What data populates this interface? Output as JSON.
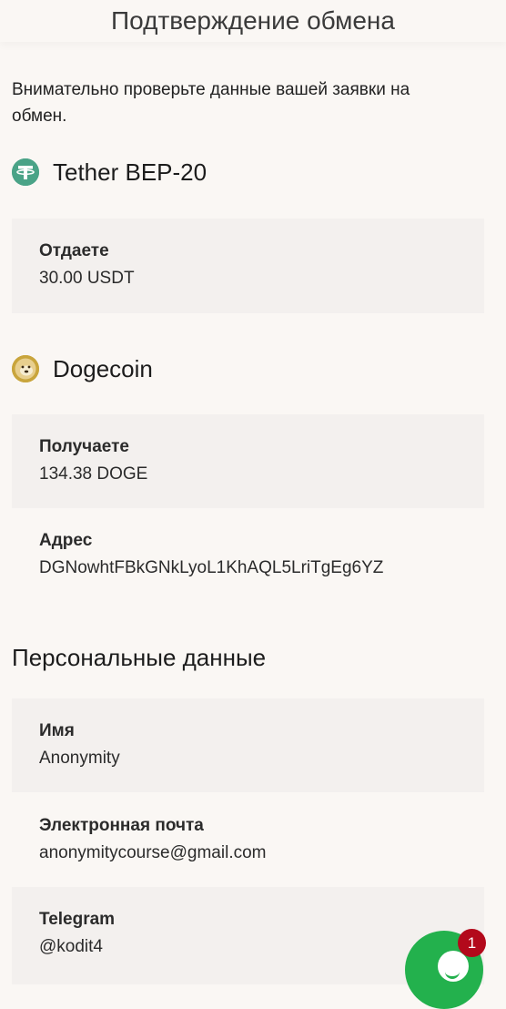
{
  "header": {
    "title": "Подтверждение обмена"
  },
  "intro": {
    "text": "Внимательно проверьте данные вашей заявки на обмен."
  },
  "give": {
    "coin_name": "Tether BEP-20",
    "coin_icon": "tether-icon",
    "label": "Отдаете",
    "amount": "30.00 USDT"
  },
  "receive": {
    "coin_name": "Dogecoin",
    "coin_icon": "dogecoin-icon",
    "label": "Получаете",
    "amount": "134.38 DOGE",
    "address_label": "Адрес",
    "address_value": "DGNowhtFBkGNkLyoL1KhAQL5LriTgEg6YZ"
  },
  "personal": {
    "title": "Персональные данные",
    "name_label": "Имя",
    "name_value": "Anonymity",
    "email_label": "Электронная почта",
    "email_value": "anonymitycourse@gmail.com",
    "telegram_label": "Telegram",
    "telegram_value": "@kodit4"
  },
  "chat": {
    "icon": "chat-icon",
    "badge_count": "1",
    "colors": {
      "bubble": "#23b14d",
      "badge": "#b3091b"
    }
  },
  "colors": {
    "background": "#faf7f4",
    "card": "#f3f0ee",
    "tether": "#4aa387",
    "doge": "#c9a53c"
  }
}
